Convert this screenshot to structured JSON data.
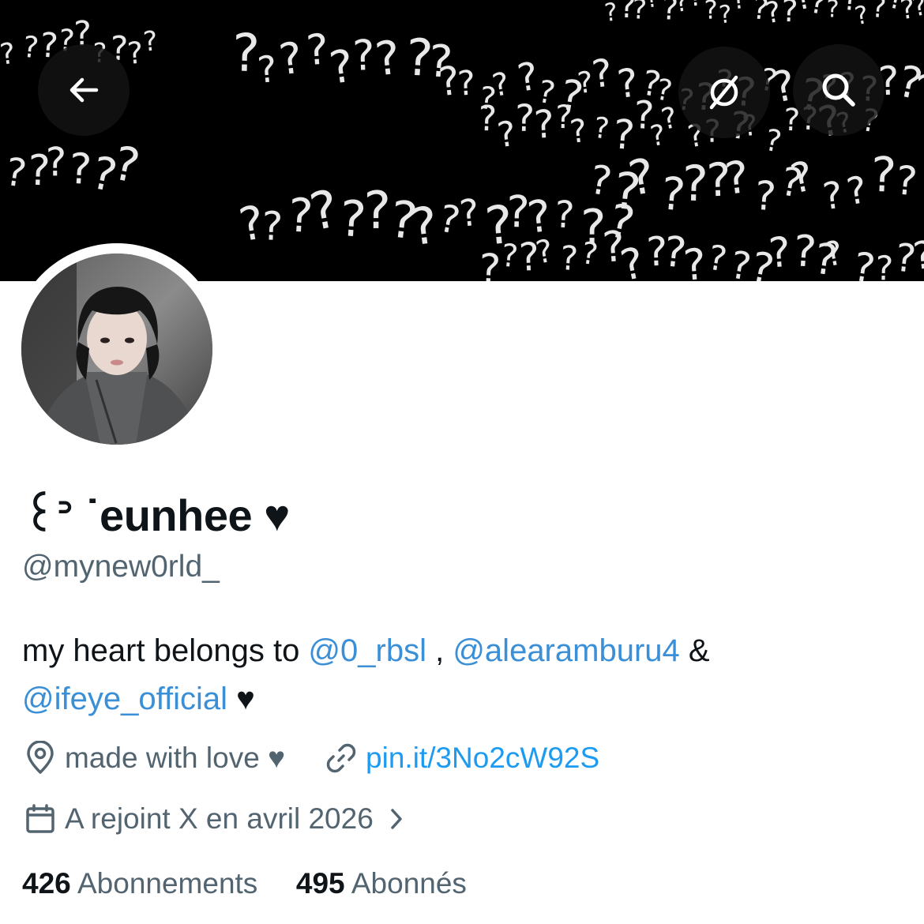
{
  "header": {
    "back_icon": "arrow-left-icon",
    "grok_icon": "slash-circle-icon",
    "search_icon": "search-icon",
    "banner_glyph": "?"
  },
  "profile": {
    "display_name": "꒰ᐣ ˙eunhee ♥",
    "handle": "@mynew0rld_",
    "bio": {
      "prefix": "my heart belongs to ",
      "mention1": "@0_rbsl",
      "sep1": " , ",
      "mention2": "@alearamburu4",
      "sep2": " &",
      "mention3": "@ifeye_official",
      "suffix": " ♥"
    },
    "location": "made with love ♥",
    "website": "pin.it/3No2cW92S",
    "joined": "A rejoint X en avril 2026",
    "following_count": "426",
    "following_label": "Abonnements",
    "followers_count": "495",
    "followers_label": "Abonnés"
  },
  "colors": {
    "link": "#1d9bf0",
    "secondary_text": "#536471",
    "primary_text": "#0f1419"
  }
}
